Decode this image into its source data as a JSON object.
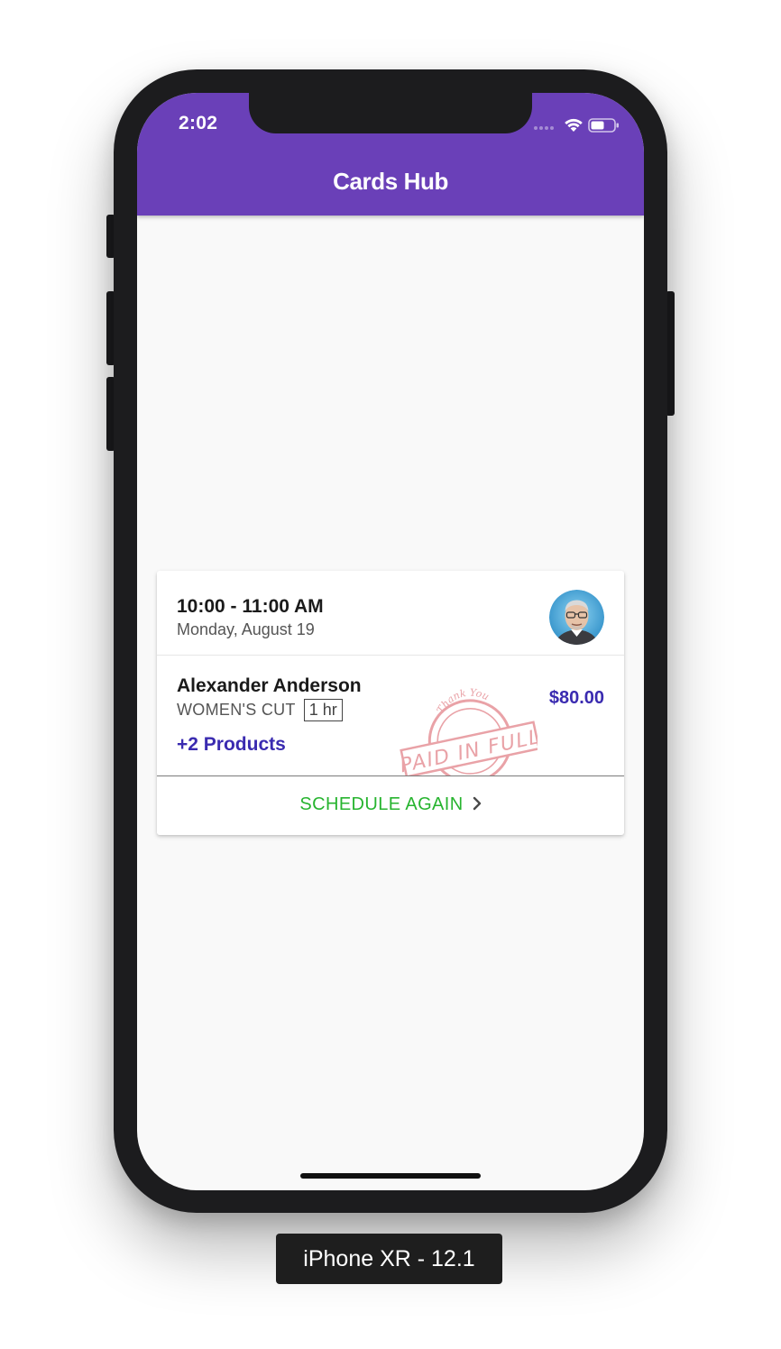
{
  "status_bar": {
    "time": "2:02"
  },
  "header": {
    "title": "Cards Hub",
    "background_color": "#6a40b8"
  },
  "appointment_card": {
    "time_range": "10:00 - 11:00 AM",
    "date": "Monday, August 19",
    "avatar_icon": "stylized-portrait-avatar",
    "client_name": "Alexander Anderson",
    "service": "WOMEN'S CUT",
    "duration": "1 hr",
    "products": "+2 Products",
    "price": "$80.00",
    "stamp": {
      "top_text": "Thank You",
      "main_text": "PAID IN FULL",
      "color": "#e9a2a7"
    },
    "action_label": "SCHEDULE AGAIN",
    "action_icon": "chevron-right-icon",
    "accent_color": "#3a2bb0",
    "action_color": "#27b42f"
  },
  "device_label": "iPhone XR - 12.1"
}
